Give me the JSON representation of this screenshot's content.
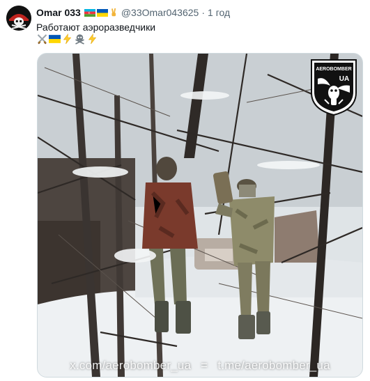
{
  "tweet": {
    "author_name": "Omar 033",
    "author_flags": [
      "azerbaijan-flag",
      "ukraine-flag",
      "victory-hand"
    ],
    "handle": "@33Omar043625",
    "separator": "·",
    "timestamp": "1 год",
    "text": "Работают аэроразведчики",
    "emoji_row": [
      "crossed-swords-icon",
      "ukraine-flag",
      "lightning-icon",
      "skull-crossbones-icon",
      "lightning-icon"
    ]
  },
  "media": {
    "type": "video-frame",
    "logo_text_top": "AEROBOMBER",
    "logo_text_mid": "UA",
    "watermark_left": "x.com/aerobomber_ua",
    "watermark_sep": "=",
    "watermark_right": "t.me/aerobomber_ua"
  },
  "colors": {
    "name_text": "#0f1419",
    "secondary_text": "#536471",
    "border": "#cfd9de"
  }
}
